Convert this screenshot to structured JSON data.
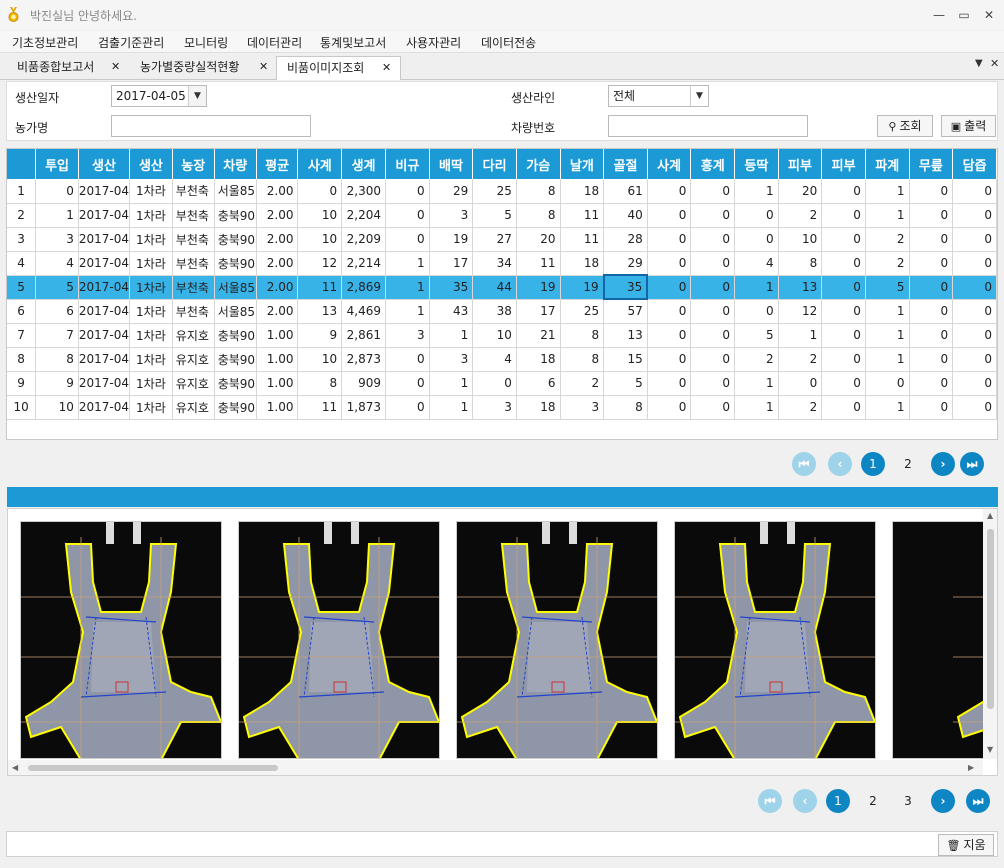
{
  "window": {
    "title": "박진실님 안녕하세요.",
    "minimize": "—",
    "restore": "▭",
    "close": "✕"
  },
  "menu": [
    "기초정보관리",
    "검출기준관리",
    "모니터링",
    "데이터관리",
    "통계및보고서",
    "사용자관리",
    "데이터전송"
  ],
  "tabs": [
    {
      "label": "비품종합보고서",
      "close": "✕"
    },
    {
      "label": "농가별중량실적현황",
      "close": "✕"
    },
    {
      "label": "비품이미지조회",
      "close": "✕",
      "active": true
    }
  ],
  "tab_controls": {
    "dropdown": "▼",
    "close": "✕"
  },
  "filters": {
    "production_date_label": "생산일자",
    "production_date_value": "2017-04-05",
    "production_line_label": "생산라인",
    "production_line_value": "전체",
    "farm_name_label": "농가명",
    "farm_name_value": "",
    "vehicle_no_label": "차량번호",
    "vehicle_no_value": "",
    "search_button": "조회",
    "print_button": "출력"
  },
  "grid": {
    "headers": [
      "",
      "투입",
      "생산",
      "생산",
      "농장",
      "차량",
      "평균",
      "사계",
      "생계",
      "비규",
      "배딱",
      "다리",
      "가슴",
      "날개",
      "골절",
      "사계",
      "홍계",
      "등딱",
      "피부",
      "피부",
      "파계",
      "무릎",
      "담즙"
    ],
    "rows": [
      [
        "1",
        "0",
        "2017-04",
        "1차라",
        "부천축",
        "서울85",
        "2.00",
        "0",
        "2,300",
        "0",
        "29",
        "25",
        "8",
        "18",
        "61",
        "0",
        "0",
        "1",
        "20",
        "0",
        "1",
        "0",
        "0"
      ],
      [
        "2",
        "1",
        "2017-04",
        "1차라",
        "부천축",
        "충북90",
        "2.00",
        "10",
        "2,204",
        "0",
        "3",
        "5",
        "8",
        "11",
        "40",
        "0",
        "0",
        "0",
        "2",
        "0",
        "1",
        "0",
        "0"
      ],
      [
        "3",
        "3",
        "2017-04",
        "1차라",
        "부천축",
        "충북90",
        "2.00",
        "10",
        "2,209",
        "0",
        "19",
        "27",
        "20",
        "11",
        "28",
        "0",
        "0",
        "0",
        "10",
        "0",
        "2",
        "0",
        "0"
      ],
      [
        "4",
        "4",
        "2017-04",
        "1차라",
        "부천축",
        "충북90",
        "2.00",
        "12",
        "2,214",
        "1",
        "17",
        "34",
        "11",
        "18",
        "29",
        "0",
        "0",
        "4",
        "8",
        "0",
        "2",
        "0",
        "0"
      ],
      [
        "5",
        "5",
        "2017-04",
        "1차라",
        "부천축",
        "서울85",
        "2.00",
        "11",
        "2,869",
        "1",
        "35",
        "44",
        "19",
        "19",
        "35",
        "0",
        "0",
        "1",
        "13",
        "0",
        "5",
        "0",
        "0"
      ],
      [
        "6",
        "6",
        "2017-04",
        "1차라",
        "부천축",
        "서울85",
        "2.00",
        "13",
        "4,469",
        "1",
        "43",
        "38",
        "17",
        "25",
        "57",
        "0",
        "0",
        "0",
        "12",
        "0",
        "1",
        "0",
        "0"
      ],
      [
        "7",
        "7",
        "2017-04",
        "1차라",
        "유지호",
        "충북90",
        "1.00",
        "9",
        "2,861",
        "3",
        "1",
        "10",
        "21",
        "8",
        "13",
        "0",
        "0",
        "5",
        "1",
        "0",
        "1",
        "0",
        "0"
      ],
      [
        "8",
        "8",
        "2017-04",
        "1차라",
        "유지호",
        "충북90",
        "1.00",
        "10",
        "2,873",
        "0",
        "3",
        "4",
        "18",
        "8",
        "15",
        "0",
        "0",
        "2",
        "2",
        "0",
        "1",
        "0",
        "0"
      ],
      [
        "9",
        "9",
        "2017-04",
        "1차라",
        "유지호",
        "충북90",
        "1.00",
        "8",
        "909",
        "0",
        "1",
        "0",
        "6",
        "2",
        "5",
        "0",
        "0",
        "1",
        "0",
        "0",
        "0",
        "0",
        "0"
      ],
      [
        "10",
        "10",
        "2017-04",
        "1차라",
        "유지호",
        "충북90",
        "1.00",
        "11",
        "1,873",
        "0",
        "1",
        "3",
        "18",
        "3",
        "8",
        "0",
        "0",
        "1",
        "2",
        "0",
        "1",
        "0",
        "0"
      ]
    ],
    "selected_row": 4
  },
  "grid_pager": {
    "first": "K",
    "prev": "‹",
    "next": "›",
    "last": "›|",
    "pages": [
      "1",
      "2"
    ],
    "current": "1"
  },
  "gallery_pager": {
    "first": "K",
    "prev": "‹",
    "next": "›",
    "last": "›|",
    "pages": [
      "1",
      "2",
      "3"
    ],
    "current": "1"
  },
  "footer": {
    "clear_button": "지움"
  },
  "colors": {
    "accent": "#1b9ad6",
    "selected_row": "#38b3e8",
    "outline": "#ffff00"
  }
}
